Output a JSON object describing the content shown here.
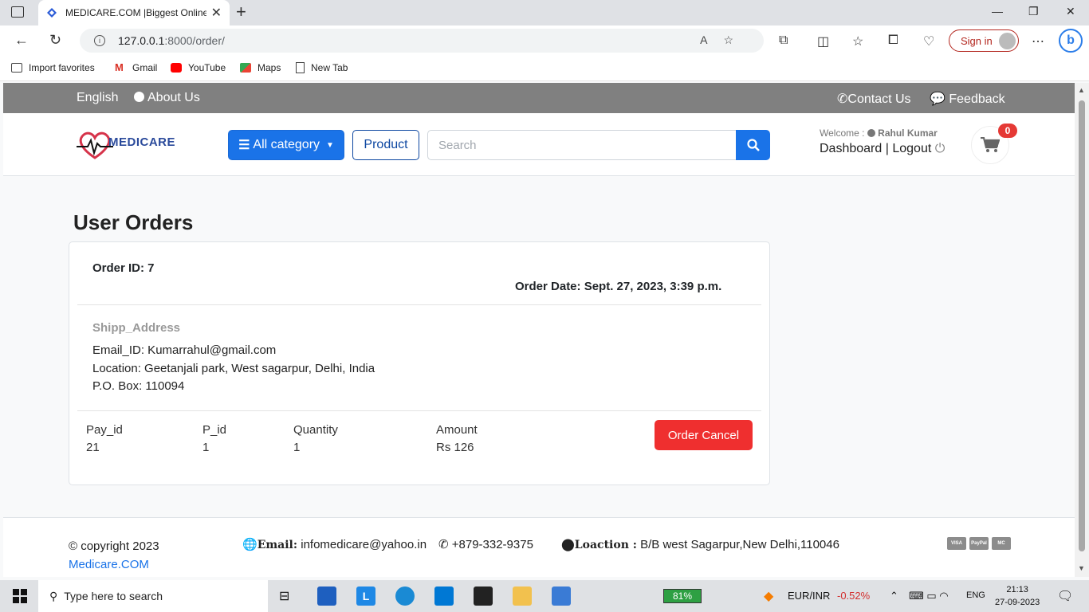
{
  "browser": {
    "tab_title": "MEDICARE.COM |Biggest Online",
    "url_host": "127.0.0.1",
    "url_path": ":8000/order/",
    "signin_label": "Sign in",
    "bookmarks": [
      "Import favorites",
      "Gmail",
      "YouTube",
      "Maps",
      "New Tab"
    ]
  },
  "topnav": {
    "language": "English",
    "about": "About Us",
    "contact": "Contact Us",
    "feedback": "Feedback"
  },
  "header": {
    "logo_text": "MEDICARE",
    "category_label": "All category",
    "product_label": "Product",
    "search_placeholder": "Search",
    "welcome_prefix": "Welcome :",
    "user_name": "Rahul Kumar",
    "dashboard": "Dashboard",
    "separator": "|",
    "logout": "Logout",
    "cart_count": "0"
  },
  "main": {
    "title": "User Orders",
    "order": {
      "id_label": "Order ID: 7",
      "date_label": "Order Date: Sept. 27, 2023, 3:39 p.m.",
      "ship_heading": "Shipp_Address",
      "email": "Email_ID: Kumarrahul@gmail.com",
      "location": "Location: Geetanjali park, West sagarpur, Delhi, India",
      "pobox": "P.O. Box: 110094",
      "columns": [
        {
          "header": "Pay_id",
          "value": "21"
        },
        {
          "header": "P_id",
          "value": "1"
        },
        {
          "header": "Quantity",
          "value": "1"
        },
        {
          "header": "Amount",
          "value": "Rs 126"
        }
      ],
      "cancel_label": "Order Cancel"
    }
  },
  "footer": {
    "copyright": "© copyright 2023",
    "site_link": "Medicare.COM",
    "email_label": "Email:",
    "email_value": "infomedicare@yahoo.in",
    "phone": "+879-332-9375",
    "location_label": "Loaction :",
    "location_value": "B/B west Sagarpur,New Delhi,110046",
    "payment_cards": [
      "VISA",
      "PayPal",
      "MC"
    ]
  },
  "taskbar": {
    "search_placeholder": "Type here to search",
    "battery": "81%",
    "currency": "EUR/INR",
    "currency_change": "-0.52%",
    "lang": "ENG",
    "time": "21:13",
    "date": "27-09-2023"
  },
  "colors": {
    "primary": "#1a73e8",
    "danger": "#ef2f2f",
    "topnav_bg": "#808080"
  }
}
